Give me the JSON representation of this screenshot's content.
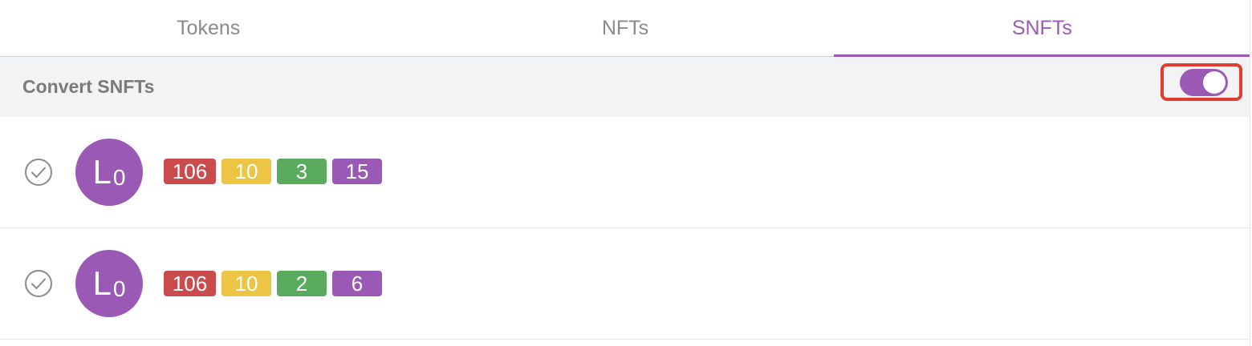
{
  "tabs": [
    {
      "label": "Tokens",
      "active": false
    },
    {
      "label": "NFTs",
      "active": false
    },
    {
      "label": "SNFTs",
      "active": true
    }
  ],
  "convert": {
    "label": "Convert SNFTs",
    "toggle_on": true
  },
  "colors": {
    "accent": "#9b59b6",
    "badge_red": "#c94b4b",
    "badge_yellow": "#ecc545",
    "badge_green": "#5aab5e",
    "badge_purple": "#9b59b6",
    "highlight": "#e03c2f"
  },
  "items": [
    {
      "check_icon": "check-circle-icon",
      "avatar": {
        "letter": "L",
        "sub": "0"
      },
      "badges": [
        "106",
        "10",
        "3",
        "15"
      ]
    },
    {
      "check_icon": "check-circle-icon",
      "avatar": {
        "letter": "L",
        "sub": "0"
      },
      "badges": [
        "106",
        "10",
        "2",
        "6"
      ]
    }
  ]
}
